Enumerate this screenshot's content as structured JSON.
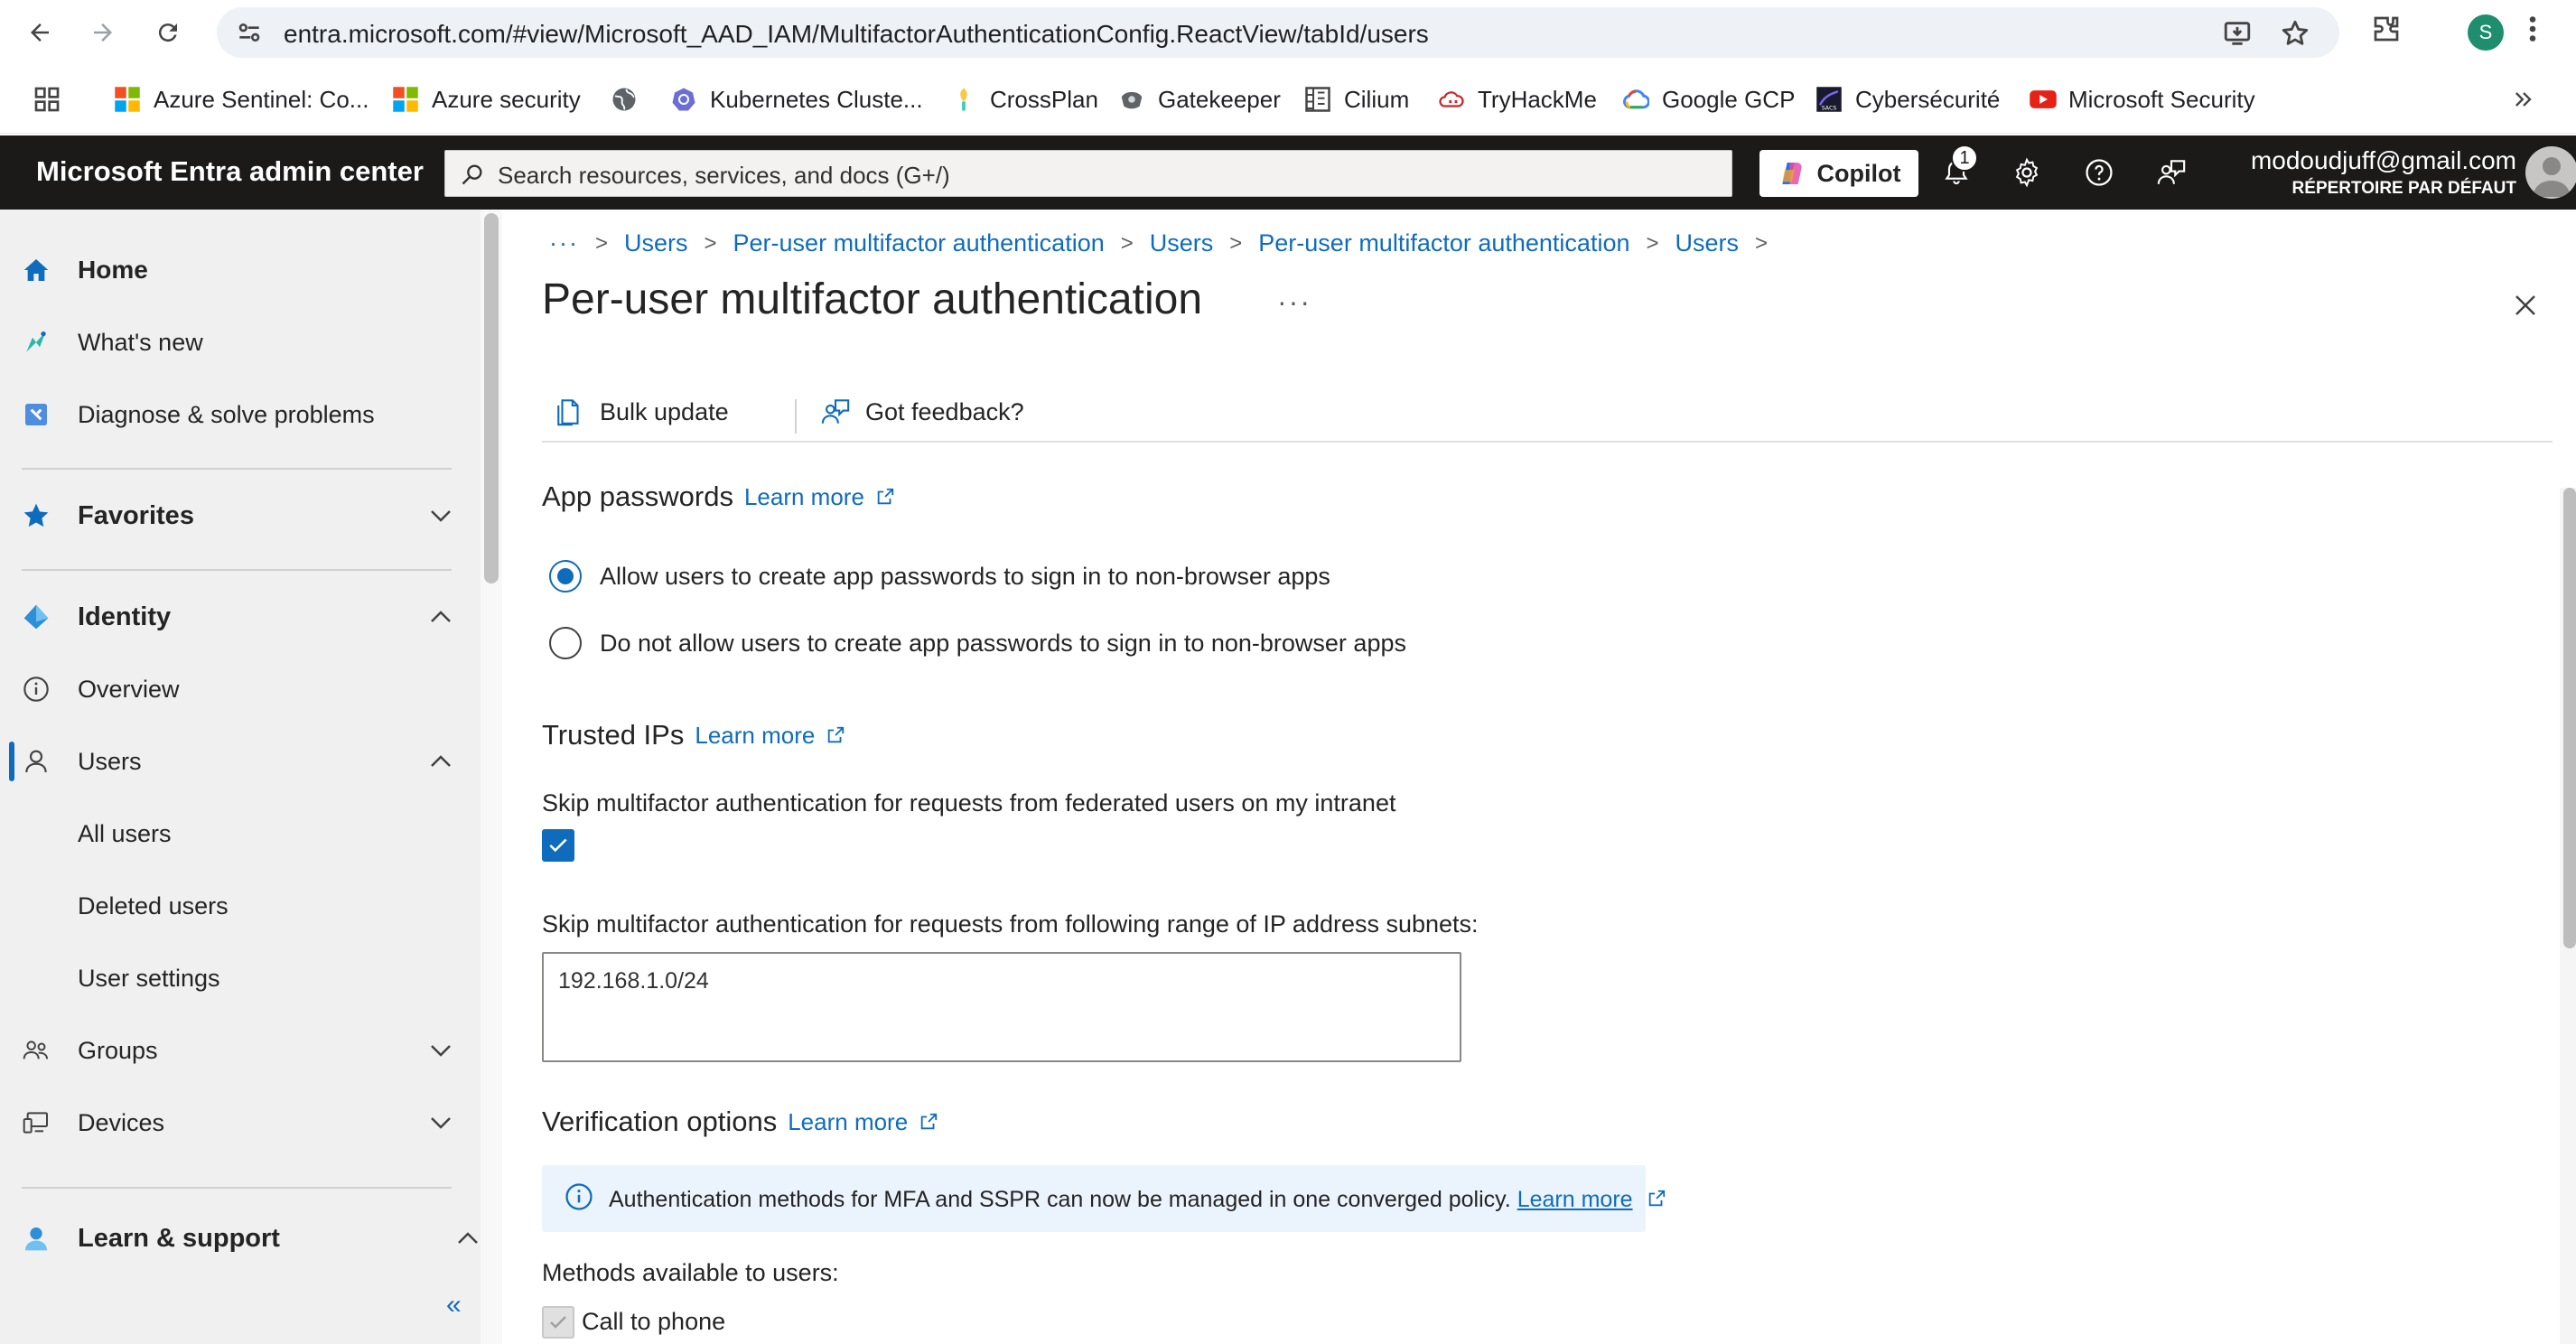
{
  "browser": {
    "url": "entra.microsoft.com/#view/Microsoft_AAD_IAM/MultifactorAuthenticationConfig.ReactView/tabId/users",
    "profile_initial": "S",
    "bookmarks": [
      {
        "label": "Azure Sentinel: Co...",
        "icon": "microsoft-logo-icon"
      },
      {
        "label": "Azure security",
        "icon": "microsoft-logo-icon"
      },
      {
        "label": "",
        "icon": "globe-icon"
      },
      {
        "label": "Kubernetes Cluste...",
        "icon": "kubernetes-icon"
      },
      {
        "label": "CrossPlan",
        "icon": "crossplane-icon"
      },
      {
        "label": "Gatekeeper",
        "icon": "gatekeeper-icon"
      },
      {
        "label": "Cilium",
        "icon": "cilium-icon"
      },
      {
        "label": "TryHackMe",
        "icon": "tryhackme-icon"
      },
      {
        "label": "Google GCP",
        "icon": "google-cloud-icon"
      },
      {
        "label": "Cybersécurité",
        "icon": "cyber-icon"
      },
      {
        "label": "Microsoft Security",
        "icon": "youtube-icon"
      }
    ]
  },
  "header": {
    "brand": "Microsoft Entra admin center",
    "search_placeholder": "Search resources, services, and docs (G+/)",
    "copilot_label": "Copilot",
    "notification_count": "1",
    "user_email": "modoudjuff@gmail.com",
    "user_directory": "RÉPERTOIRE PAR DÉFAUT"
  },
  "sidebar": {
    "items": [
      {
        "label": "Home",
        "icon": "home-icon"
      },
      {
        "label": "What's new",
        "icon": "whats-new-icon"
      },
      {
        "label": "Diagnose & solve problems",
        "icon": "diagnose-icon"
      },
      {
        "label": "Favorites",
        "icon": "star-icon"
      },
      {
        "label": "Identity",
        "icon": "identity-icon"
      },
      {
        "label": "Overview",
        "icon": "info-icon"
      },
      {
        "label": "Users",
        "icon": "person-icon"
      },
      {
        "label": "All users"
      },
      {
        "label": "Deleted users"
      },
      {
        "label": "User settings"
      },
      {
        "label": "Groups",
        "icon": "groups-icon"
      },
      {
        "label": "Devices",
        "icon": "devices-icon"
      },
      {
        "label": "Learn & support",
        "icon": "learn-support-icon"
      }
    ],
    "collapse_label": "«"
  },
  "main": {
    "breadcrumb": {
      "more": "···",
      "items": [
        "Users",
        "Per-user multifactor authentication",
        "Users",
        "Per-user multifactor authentication",
        "Users"
      ]
    },
    "title": "Per-user multifactor authentication",
    "title_more": "···",
    "commands": {
      "bulk_update": "Bulk update",
      "feedback": "Got feedback?"
    },
    "app_passwords": {
      "heading": "App passwords",
      "learn_more": "Learn more",
      "options": [
        {
          "label": "Allow users to create app passwords to sign in to non-browser apps",
          "selected": true
        },
        {
          "label": "Do not allow users to create app passwords to sign in to non-browser apps",
          "selected": false
        }
      ]
    },
    "trusted_ips": {
      "heading": "Trusted IPs",
      "learn_more": "Learn more",
      "skip_federated_label": "Skip multifactor authentication for requests from federated users on my intranet",
      "skip_federated_checked": true,
      "subnets_label": "Skip multifactor authentication for requests from following range of IP address subnets:",
      "subnets_value": "192.168.1.0/24"
    },
    "verification": {
      "heading": "Verification options",
      "learn_more": "Learn more",
      "info_text": "Authentication methods for MFA and SSPR can now be managed in one converged policy.",
      "info_link": "Learn more",
      "methods_label": "Methods available to users:",
      "methods": [
        {
          "label": "Call to phone",
          "checked": true,
          "disabled": true
        }
      ]
    }
  },
  "colors": {
    "accent": "#0f6cbd",
    "header_bg": "#1b1a19",
    "sidebar_bg": "#f0f0f0",
    "info_bg": "#ebf3fc"
  }
}
